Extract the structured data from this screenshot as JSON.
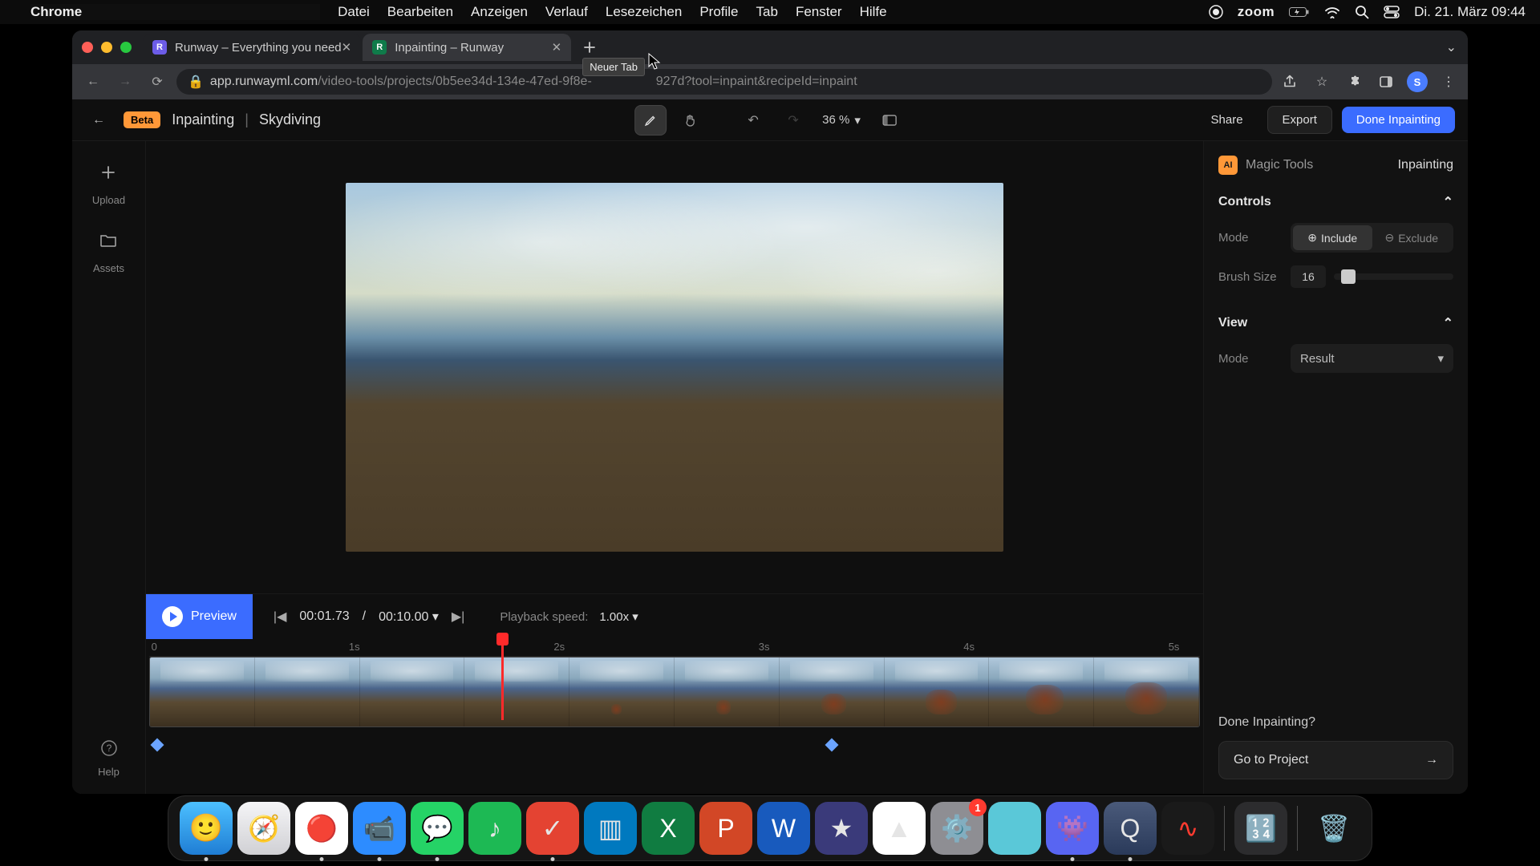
{
  "menubar": {
    "app": "Chrome",
    "items": [
      "Datei",
      "Bearbeiten",
      "Anzeigen",
      "Verlauf",
      "Lesezeichen",
      "Profile",
      "Tab",
      "Fenster",
      "Hilfe"
    ],
    "zoom": "zoom",
    "datetime": "Di. 21. März  09:44"
  },
  "tabs": {
    "t1": "Runway – Everything you need",
    "t2": "Inpainting – Runway",
    "newtab_tooltip": "Neuer Tab"
  },
  "url": {
    "host": "app.runwayml.com",
    "path_a": "/video-tools/projects/0b5ee34d-134e-47ed-9f8e-",
    "path_b": "927d?tool=inpaint&recipeId=inpaint"
  },
  "header": {
    "beta": "Beta",
    "crumb1": "Inpainting",
    "crumb2": "Skydiving",
    "zoom": "36 %",
    "share": "Share",
    "export": "Export",
    "done": "Done Inpainting"
  },
  "rail": {
    "upload": "Upload",
    "assets": "Assets",
    "help": "Help"
  },
  "panel": {
    "magic": "Magic Tools",
    "inpainting": "Inpainting",
    "controls": "Controls",
    "mode": "Mode",
    "include": "Include",
    "exclude": "Exclude",
    "brush": "Brush Size",
    "brush_val": "16",
    "view": "View",
    "view_mode": "Mode",
    "result": "Result",
    "done_q": "Done Inpainting?",
    "goto": "Go to Project"
  },
  "playback": {
    "preview": "Preview",
    "current": "00:01.73",
    "sep": "/",
    "total": "00:10.00",
    "speed_lbl": "Playback speed:",
    "speed_val": "1.00x"
  },
  "ruler": {
    "t0": "0",
    "t1": "1s",
    "t2": "2s",
    "t3": "3s",
    "t4": "4s",
    "t5": "5s"
  },
  "dock": {
    "badge": "1"
  },
  "avatar": "S",
  "ai": "AI"
}
